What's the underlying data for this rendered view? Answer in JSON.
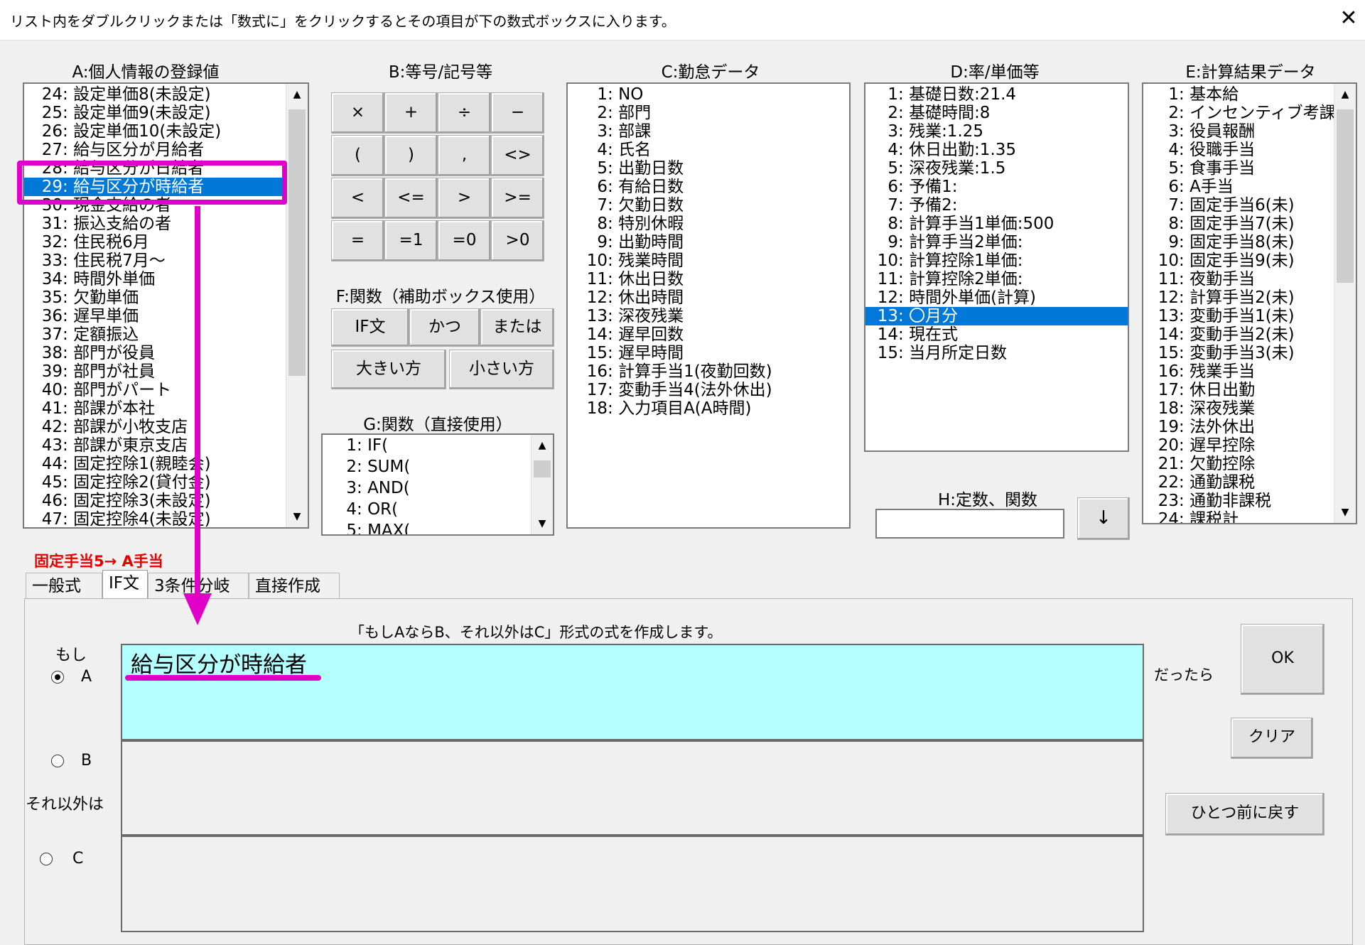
{
  "title": {
    "text": "リスト内をダブルクリックまたは「数式に」をクリックするとその項目が下の数式ボックスに入ります。",
    "close": "✕"
  },
  "headers": {
    "a": "A:個人情報の登録値",
    "b": "B:等号/記号等",
    "c": "C:勤怠データ",
    "d": "D:率/単価等",
    "e": "E:計算結果データ",
    "f": "F:関数（補助ボックス使用）",
    "g": "G:関数（直接使用）",
    "h": "H:定数、関数"
  },
  "listA": [
    {
      "n": "24",
      "t": "設定単価8(未設定)"
    },
    {
      "n": "25",
      "t": "設定単価9(未設定)"
    },
    {
      "n": "26",
      "t": "設定単価10(未設定)"
    },
    {
      "n": "27",
      "t": "給与区分が月給者"
    },
    {
      "n": "28",
      "t": "給与区分が日給者"
    },
    {
      "n": "29",
      "t": "給与区分が時給者"
    },
    {
      "n": "30",
      "t": "現金支給の者"
    },
    {
      "n": "31",
      "t": "振込支給の者"
    },
    {
      "n": "32",
      "t": "住民税6月"
    },
    {
      "n": "33",
      "t": "住民税7月～"
    },
    {
      "n": "34",
      "t": "時間外単価"
    },
    {
      "n": "35",
      "t": "欠勤単価"
    },
    {
      "n": "36",
      "t": "遅早単価"
    },
    {
      "n": "37",
      "t": "定額振込"
    },
    {
      "n": "38",
      "t": "部門が役員"
    },
    {
      "n": "39",
      "t": "部門が社員"
    },
    {
      "n": "40",
      "t": "部門がパート"
    },
    {
      "n": "41",
      "t": "部課が本社"
    },
    {
      "n": "42",
      "t": "部課が小牧支店"
    },
    {
      "n": "43",
      "t": "部課が東京支店"
    },
    {
      "n": "44",
      "t": "固定控除1(親睦会)"
    },
    {
      "n": "45",
      "t": "固定控除2(貸付金)"
    },
    {
      "n": "46",
      "t": "固定控除3(未設定)"
    },
    {
      "n": "47",
      "t": "固定控除4(未設定)"
    }
  ],
  "listA_selected_index": 5,
  "symbols": [
    "×",
    "+",
    "÷",
    "−",
    "(",
    ")",
    ",",
    "<>",
    "<",
    "<=",
    ">",
    ">=",
    "=",
    "=1",
    "=0",
    ">0"
  ],
  "f_buttons": {
    "if": "IF文",
    "and": "かつ",
    "or": "または",
    "max": "大きい方",
    "min": "小さい方"
  },
  "listG": [
    {
      "n": "1",
      "t": "IF("
    },
    {
      "n": "2",
      "t": "SUM("
    },
    {
      "n": "3",
      "t": "AND("
    },
    {
      "n": "4",
      "t": "OR("
    },
    {
      "n": "5",
      "t": "MAX("
    }
  ],
  "listC": [
    {
      "n": "1",
      "t": "NO"
    },
    {
      "n": "2",
      "t": "部門"
    },
    {
      "n": "3",
      "t": "部課"
    },
    {
      "n": "4",
      "t": "氏名"
    },
    {
      "n": "5",
      "t": "出勤日数"
    },
    {
      "n": "6",
      "t": "有給日数"
    },
    {
      "n": "7",
      "t": "欠勤日数"
    },
    {
      "n": "8",
      "t": "特別休暇"
    },
    {
      "n": "9",
      "t": "出勤時間"
    },
    {
      "n": "10",
      "t": "残業時間"
    },
    {
      "n": "11",
      "t": "休出日数"
    },
    {
      "n": "12",
      "t": "休出時間"
    },
    {
      "n": "13",
      "t": "深夜残業"
    },
    {
      "n": "14",
      "t": "遅早回数"
    },
    {
      "n": "15",
      "t": "遅早時間"
    },
    {
      "n": "16",
      "t": "計算手当1(夜勤回数)"
    },
    {
      "n": "17",
      "t": "変動手当4(法外休出)"
    },
    {
      "n": "18",
      "t": "入力項目A(A時間)"
    }
  ],
  "listD": [
    {
      "n": "1",
      "t": "基礎日数:21.4"
    },
    {
      "n": "2",
      "t": "基礎時間:8"
    },
    {
      "n": "3",
      "t": "残業:1.25"
    },
    {
      "n": "4",
      "t": "休日出勤:1.35"
    },
    {
      "n": "5",
      "t": "深夜残業:1.5"
    },
    {
      "n": "6",
      "t": "予備1:"
    },
    {
      "n": "7",
      "t": "予備2:"
    },
    {
      "n": "8",
      "t": "計算手当1単価:500"
    },
    {
      "n": "9",
      "t": "計算手当2単価:"
    },
    {
      "n": "10",
      "t": "計算控除1単価:"
    },
    {
      "n": "11",
      "t": "計算控除2単価:"
    },
    {
      "n": "12",
      "t": "時間外単価(計算)"
    },
    {
      "n": "13",
      "t": "〇月分"
    },
    {
      "n": "14",
      "t": "現在式"
    },
    {
      "n": "15",
      "t": "当月所定日数"
    }
  ],
  "listD_selected_index": 12,
  "listE": [
    {
      "n": "1",
      "t": "基本給"
    },
    {
      "n": "2",
      "t": "インセンティブ考課"
    },
    {
      "n": "3",
      "t": "役員報酬"
    },
    {
      "n": "4",
      "t": "役職手当"
    },
    {
      "n": "5",
      "t": "食事手当"
    },
    {
      "n": "6",
      "t": "A手当"
    },
    {
      "n": "7",
      "t": "固定手当6(未)"
    },
    {
      "n": "8",
      "t": "固定手当7(未)"
    },
    {
      "n": "9",
      "t": "固定手当8(未)"
    },
    {
      "n": "10",
      "t": "固定手当9(未)"
    },
    {
      "n": "11",
      "t": "夜勤手当"
    },
    {
      "n": "12",
      "t": "計算手当2(未)"
    },
    {
      "n": "13",
      "t": "変動手当1(未)"
    },
    {
      "n": "14",
      "t": "変動手当2(未)"
    },
    {
      "n": "15",
      "t": "変動手当3(未)"
    },
    {
      "n": "16",
      "t": "残業手当"
    },
    {
      "n": "17",
      "t": "休日出勤"
    },
    {
      "n": "18",
      "t": "深夜残業"
    },
    {
      "n": "19",
      "t": "法外休出"
    },
    {
      "n": "20",
      "t": "遅早控除"
    },
    {
      "n": "21",
      "t": "欠勤控除"
    },
    {
      "n": "22",
      "t": "通勤課税"
    },
    {
      "n": "23",
      "t": "通勤非課税"
    },
    {
      "n": "24",
      "t": "課税計"
    }
  ],
  "h_input_value": "",
  "h_button": "↓",
  "target_label": "固定手当5→ A手当",
  "tabs": [
    "一般式",
    "IF文",
    "3条件分岐",
    "直接作成"
  ],
  "active_tab": 1,
  "instruction": "「もしAならB、それ以外はC」形式の式を作成します。",
  "labels": {
    "if": "もし",
    "a": "A",
    "b": "B",
    "c": "C",
    "else": "それ以外は",
    "then": "だったら"
  },
  "formula": {
    "a": "給与区分が時給者",
    "b": "",
    "c": ""
  },
  "buttons": {
    "ok": "OK",
    "clear": "クリア",
    "undo": "ひとつ前に戻す"
  },
  "colors": {
    "accent": "#0078d7",
    "highlight": "#e000c8",
    "active_box": "#b4ffff",
    "warning_text": "#e60000"
  }
}
